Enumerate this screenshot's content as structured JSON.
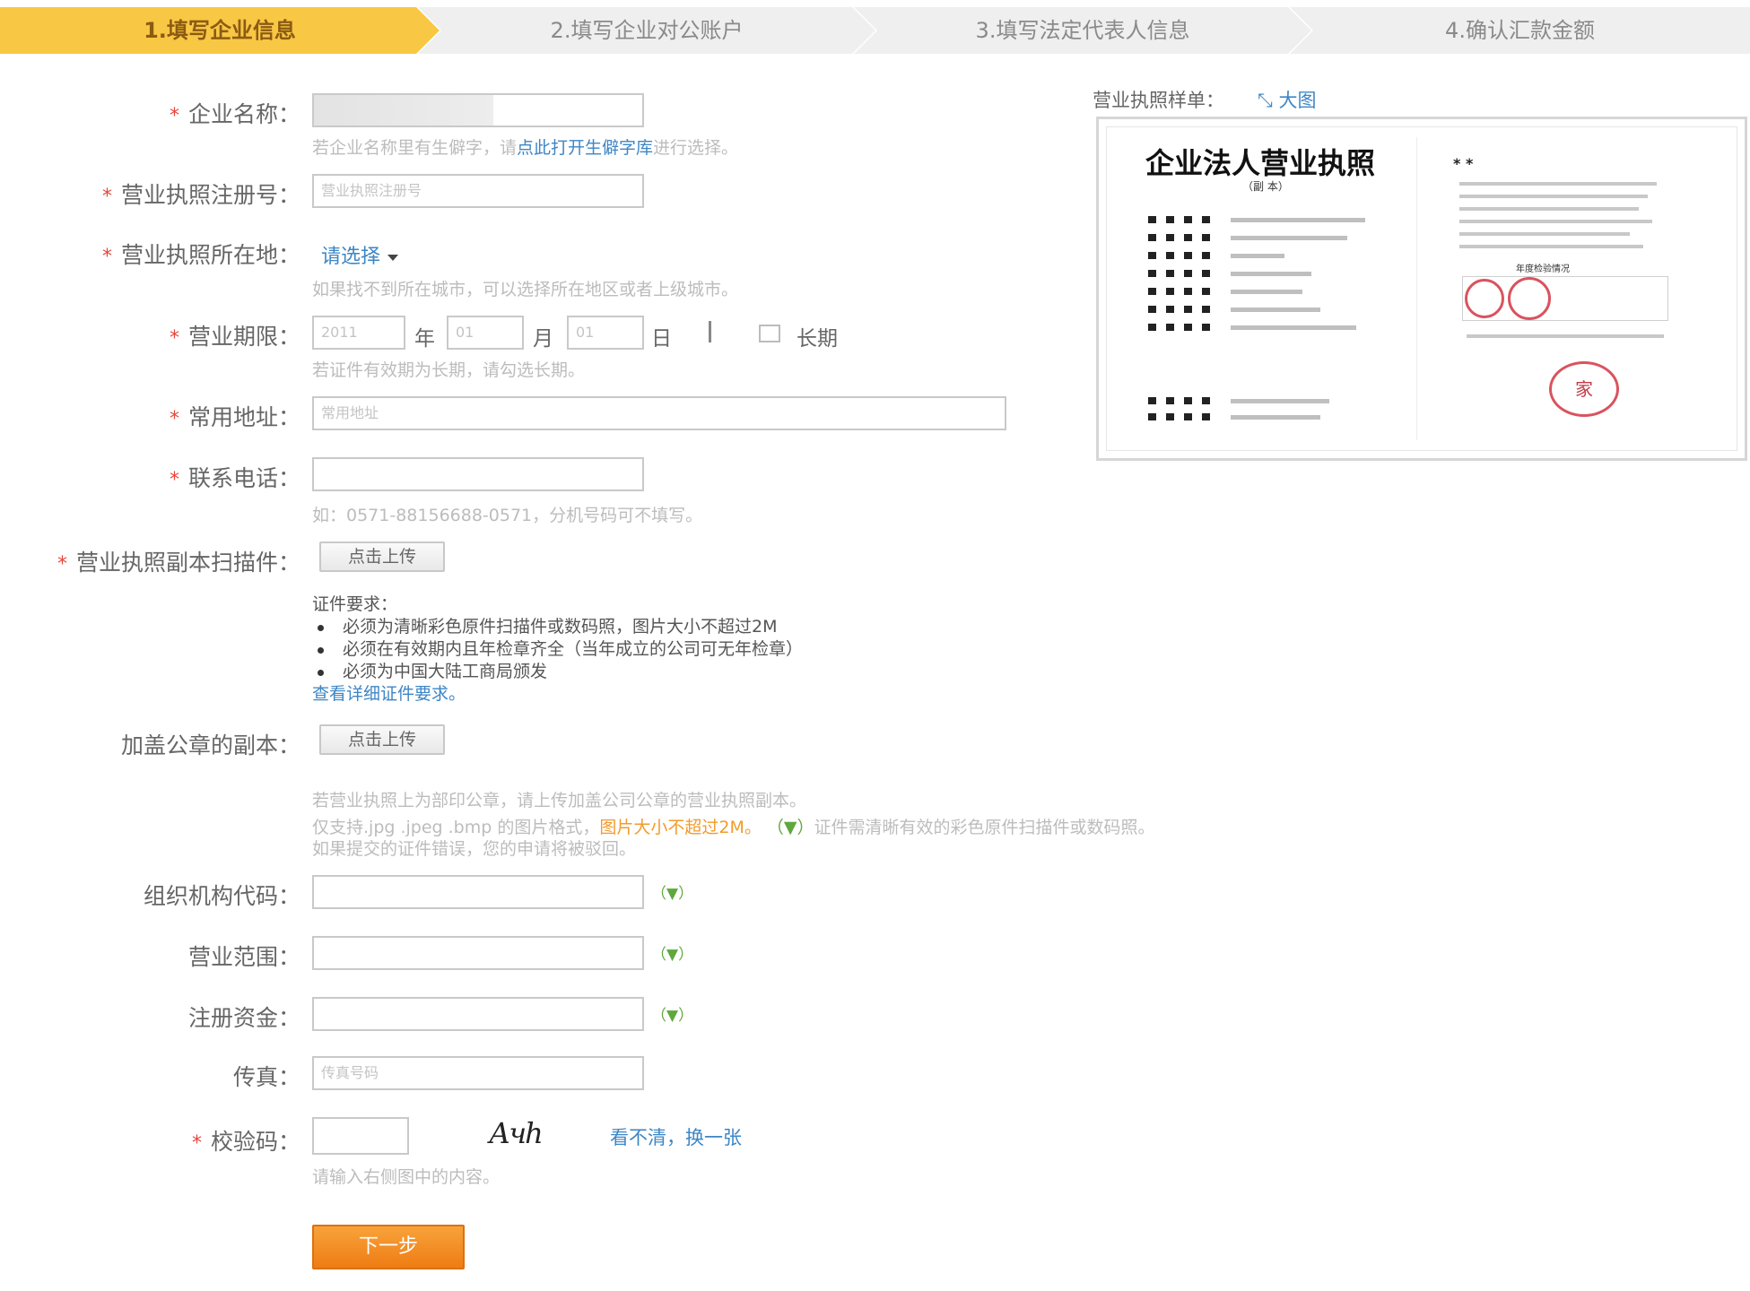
{
  "steps": [
    {
      "label": "1.填写企业信息",
      "active": true
    },
    {
      "label": "2.填写企业对公账户",
      "active": false
    },
    {
      "label": "3.填写法定代表人信息",
      "active": false
    },
    {
      "label": "4.确认汇款金额",
      "active": false
    }
  ],
  "form": {
    "required_mark": "*",
    "company_name": {
      "label": "企业名称：",
      "hint_prefix": "若企业名称里有生僻字，请",
      "hint_link": "点此打开生僻字库",
      "hint_suffix": "进行选择。"
    },
    "license_no": {
      "label": "营业执照注册号：",
      "placeholder": "营业执照注册号"
    },
    "license_location": {
      "label": "营业执照所在地：",
      "select_value": "请选择",
      "hint": "如果找不到所在城市，可以选择所在地区或者上级城市。"
    },
    "business_term": {
      "label": "营业期限：",
      "year_value": "2011",
      "year_unit": "年",
      "month_value": "01",
      "month_unit": "月",
      "day_value": "01",
      "day_unit": "日",
      "long_term_label": "长期",
      "hint": "若证件有效期为长期，请勾选长期。"
    },
    "address": {
      "label": "常用地址：",
      "placeholder": "常用地址"
    },
    "phone": {
      "label": "联系电话：",
      "hint": "如：0571-88156688-0571，分机号码可不填写。"
    },
    "license_scan": {
      "label": "营业执照副本扫描件：",
      "button": "点击上传"
    },
    "requirements": {
      "title": "证件要求：",
      "items": [
        "必须为清晰彩色原件扫描件或数码照，图片大小不超过2M",
        "必须在有效期内且年检章齐全（当年成立的公司可无年检章）",
        "必须为中国大陆工商局颁发"
      ],
      "link": "查看详细证件要求。"
    },
    "stamped_copy": {
      "label": "加盖公章的副本：",
      "button": "点击上传",
      "hint1": "若营业执照上为部印公章，请上传加盖公司公章的营业执照副本。",
      "hint2_prefix": "仅支持.jpg .jpeg .bmp 的图片格式，",
      "hint2_warn": "图片大小不超过2M。",
      "hint2_tip": "（▼）",
      "hint2_suffix": "证件需清晰有效的彩色原件扫描件或数码照。",
      "hint3": "如果提交的证件错误，您的申请将被驳回。"
    },
    "org_code": {
      "label": "组织机构代码：",
      "tip": "（▼）"
    },
    "business_scope": {
      "label": "营业范围：",
      "tip": "（▼）"
    },
    "registered_capital": {
      "label": "注册资金：",
      "tip": "（▼）"
    },
    "fax": {
      "label": "传真：",
      "placeholder": "传真号码"
    },
    "captcha": {
      "label": "校验码：",
      "image_text": "Ачh",
      "refresh": "看不清，换一张",
      "hint": "请输入右侧图中的内容。"
    },
    "next_button": "下一步"
  },
  "sample": {
    "label": "营业执照样单：",
    "link": "⤡ 大图",
    "doc_title": "企业法人营业执照",
    "doc_sub": "（副 本）",
    "right_heading": "* *",
    "right_section": "年度检验情况",
    "stamp_char": "家"
  },
  "colors": {
    "active_step": "#f8c744",
    "link": "#3d86c6",
    "required": "#e8453c",
    "next_button": "#f28c1e",
    "warning": "#f29b2b",
    "tip": "#5ea83d"
  }
}
